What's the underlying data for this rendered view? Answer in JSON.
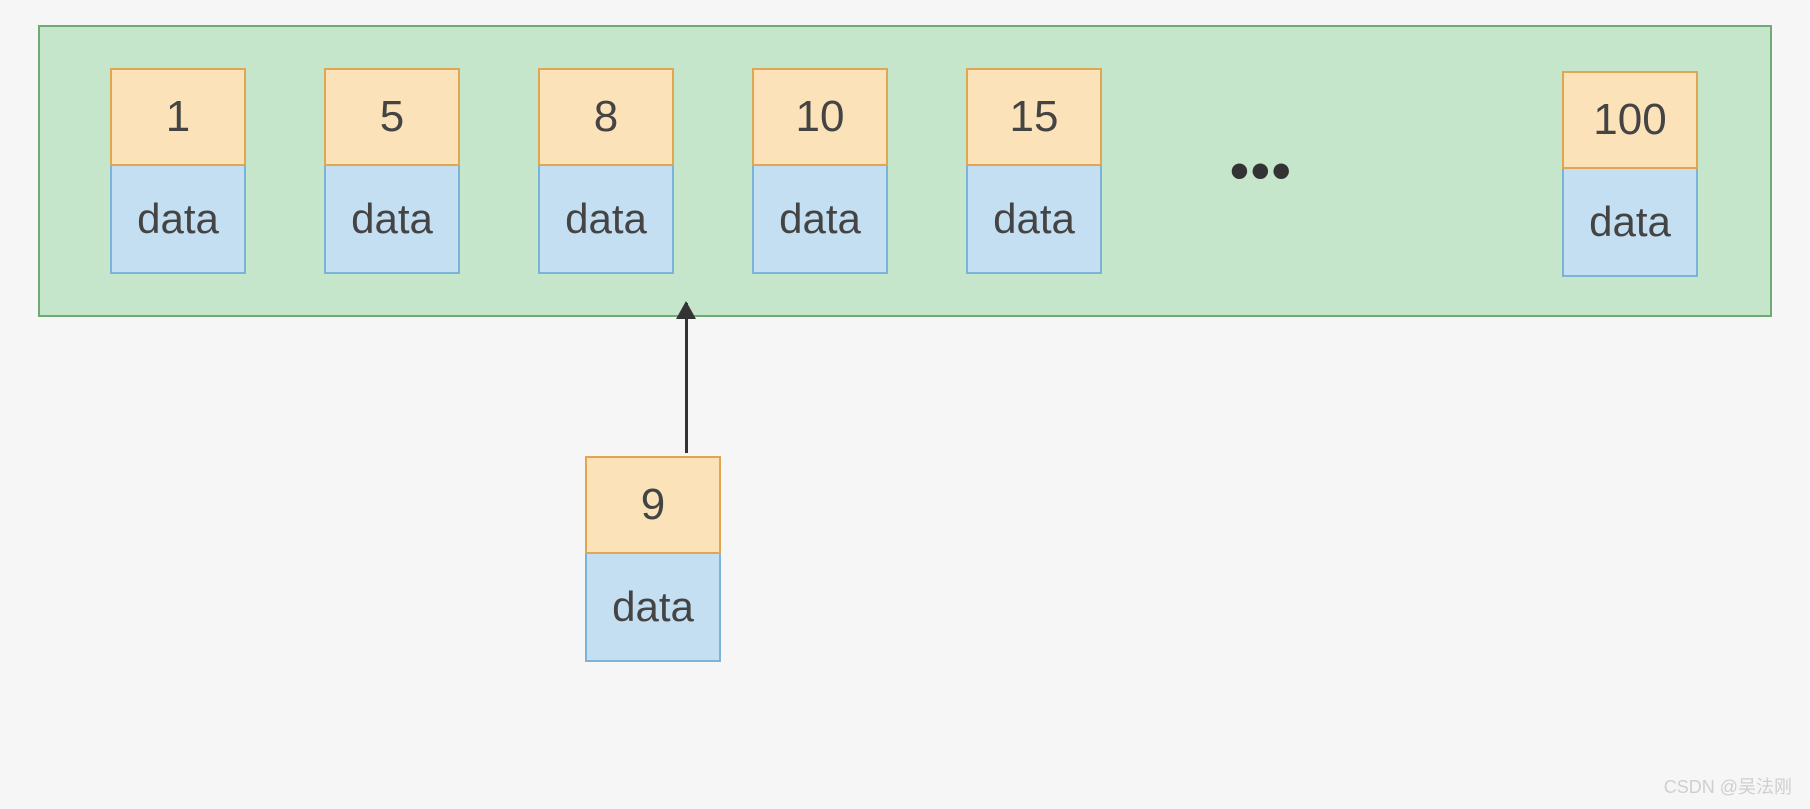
{
  "array": {
    "cells": [
      {
        "key": "1",
        "data": "data"
      },
      {
        "key": "5",
        "data": "data"
      },
      {
        "key": "8",
        "data": "data"
      },
      {
        "key": "10",
        "data": "data"
      },
      {
        "key": "15",
        "data": "data"
      }
    ],
    "ellipsis": "•••",
    "last": {
      "key": "100",
      "data": "data"
    }
  },
  "insert": {
    "key": "9",
    "data": "data"
  },
  "watermark": "CSDN @吴法刚"
}
